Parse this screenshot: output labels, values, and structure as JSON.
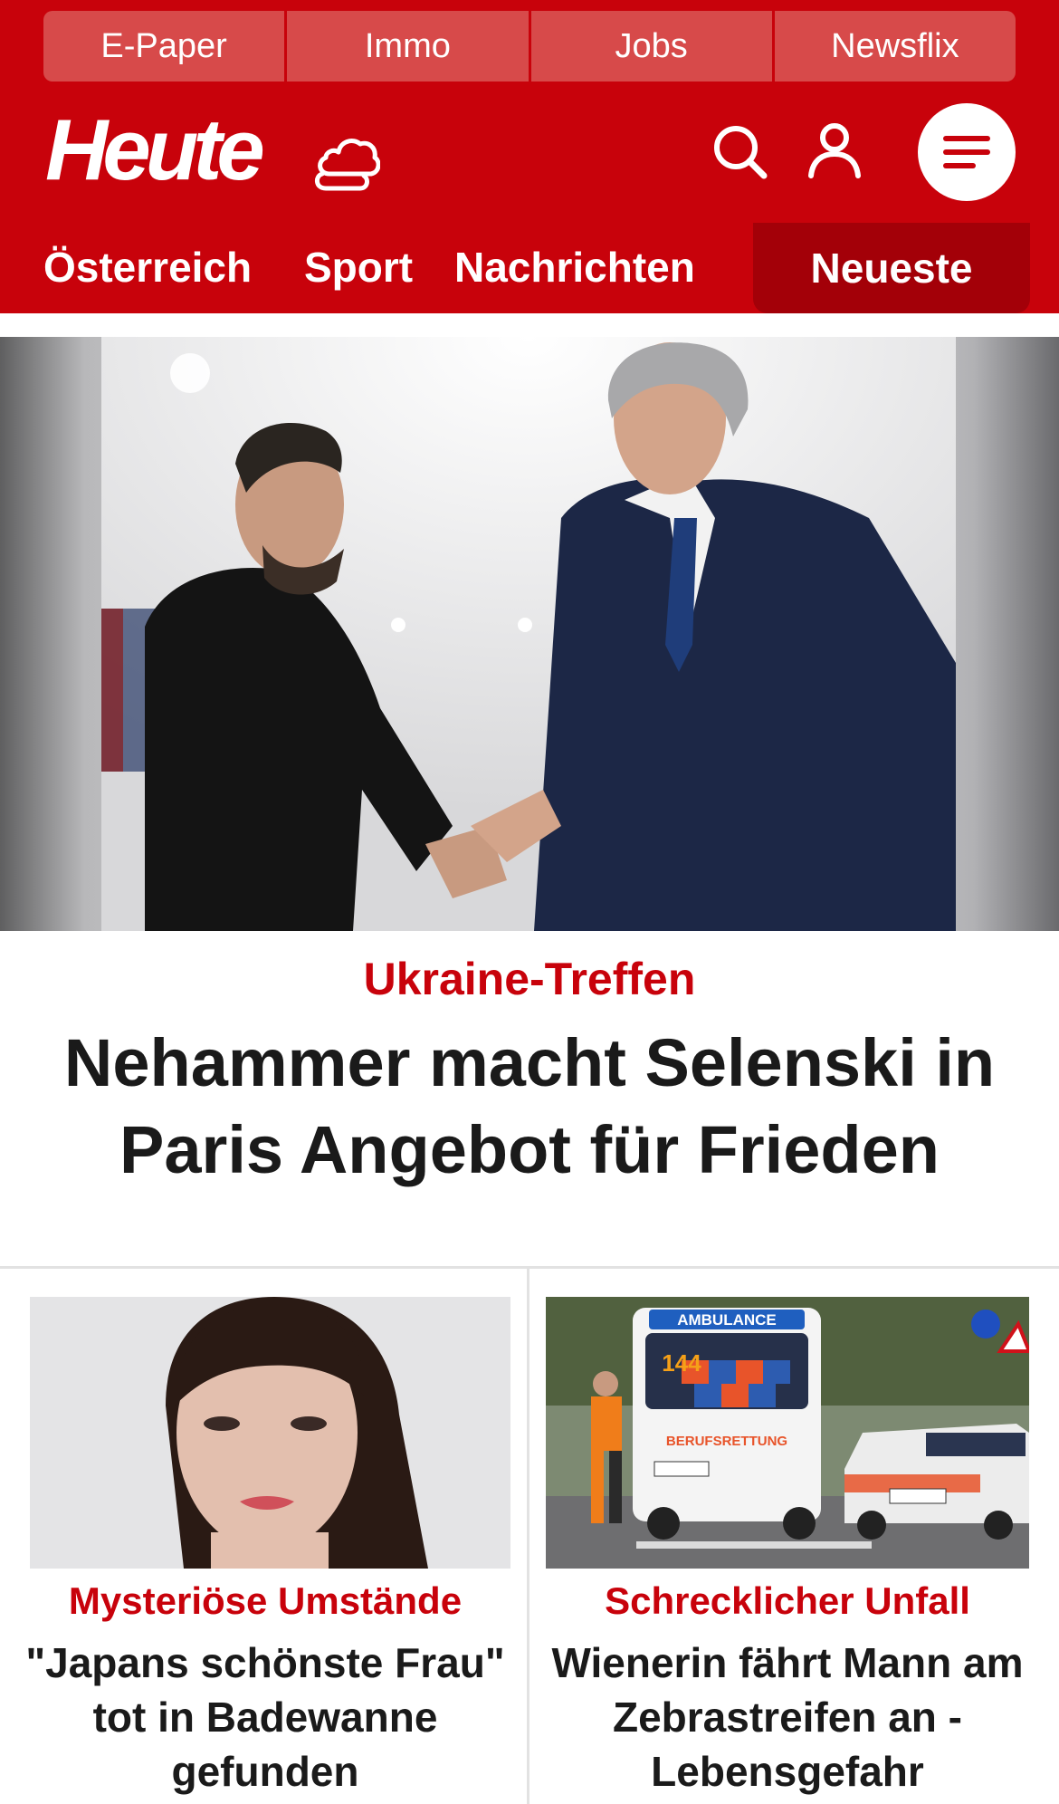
{
  "colors": {
    "brand_red": "#c8020b",
    "nav_active": "#a30008",
    "service_tab": "#d74a4a",
    "text_dark": "#1a1a1a"
  },
  "services": [
    {
      "label": "E-Paper"
    },
    {
      "label": "Immo"
    },
    {
      "label": "Jobs"
    },
    {
      "label": "Newsflix"
    }
  ],
  "header": {
    "logo_text": "Heute",
    "icons": [
      "cloud-weather-icon",
      "search-icon",
      "user-icon",
      "hamburger-menu-icon"
    ]
  },
  "nav": {
    "items": [
      {
        "label": "Österreich"
      },
      {
        "label": "Sport"
      },
      {
        "label": "Nachrichten"
      }
    ],
    "active": {
      "label": "Neueste"
    }
  },
  "hero": {
    "kicker": "Ukraine-Treffen",
    "title": "Nehammer macht Selenski in Paris Angebot für Frieden"
  },
  "cards": [
    {
      "kicker": "Mysteriöse Umstände",
      "title": "\"Japans schönste Frau\" tot in Badewanne gefunden"
    },
    {
      "kicker": "Schrecklicher Unfall",
      "title": "Wienerin fährt Mann am Zebrastreifen an - Lebensgefahr"
    }
  ],
  "photo_text": {
    "ambulance_top": "AMBULANCE",
    "ambulance_number": "144",
    "ambulance_side": "BERUFSRETTUNG"
  }
}
